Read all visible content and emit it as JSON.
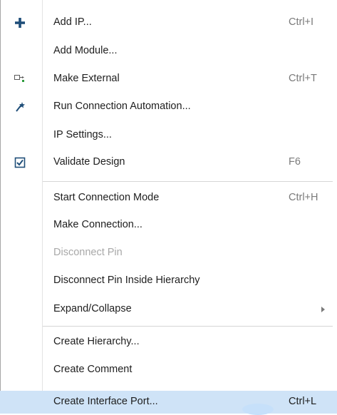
{
  "menu": {
    "items": [
      {
        "label": "Add IP...",
        "shortcut": "Ctrl+I",
        "icon": "plus-icon"
      },
      {
        "label": "Add Module...",
        "shortcut": "",
        "icon": ""
      },
      {
        "label": "Make External",
        "shortcut": "Ctrl+T",
        "icon": "make-external-icon"
      },
      {
        "label": "Run Connection Automation...",
        "shortcut": "",
        "icon": "magic-wand-icon"
      },
      {
        "label": "IP Settings...",
        "shortcut": "",
        "icon": ""
      },
      {
        "label": "Validate Design",
        "shortcut": "F6",
        "icon": "validate-checkbox-icon"
      },
      {
        "label": "Start Connection Mode",
        "shortcut": "Ctrl+H",
        "icon": ""
      },
      {
        "label": "Make Connection...",
        "shortcut": "",
        "icon": ""
      },
      {
        "label": "Disconnect Pin",
        "shortcut": "",
        "icon": "",
        "disabled": true
      },
      {
        "label": "Disconnect Pin Inside Hierarchy",
        "shortcut": "",
        "icon": ""
      },
      {
        "label": "Expand/Collapse",
        "shortcut": "",
        "icon": "",
        "submenu": true
      },
      {
        "label": "Create Hierarchy...",
        "shortcut": "",
        "icon": ""
      },
      {
        "label": "Create Comment",
        "shortcut": "",
        "icon": ""
      },
      {
        "label": "Create Interface Port...",
        "shortcut": "Ctrl+L",
        "icon": "",
        "highlighted": true
      }
    ]
  },
  "colors": {
    "highlight": "#cfe3f7",
    "text": "#1e1e1e",
    "disabled_text": "#a8a8a8",
    "shortcut_text": "#7a7a7a",
    "icon_blue": "#1f4e79"
  }
}
